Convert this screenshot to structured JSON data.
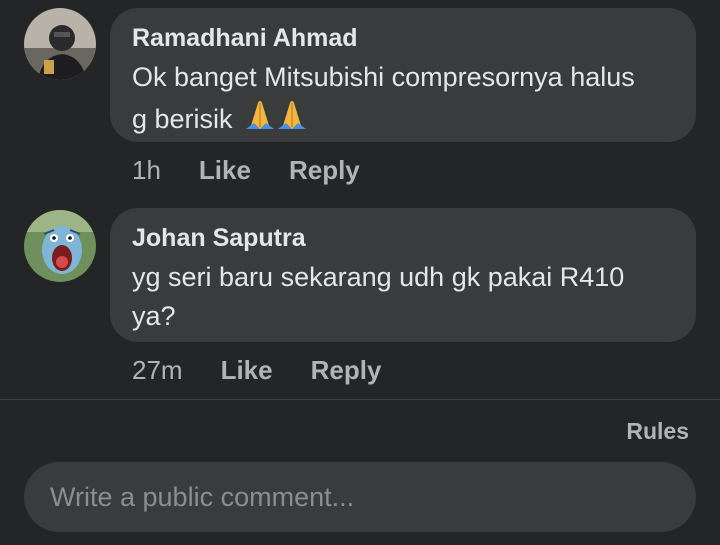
{
  "comments": [
    {
      "author": "Ramadhani Ahmad",
      "text": "Ok banget Mitsubishi compresornya halus g berisik",
      "emoji": "folded-hands-icon",
      "time": "1h",
      "like_label": "Like",
      "reply_label": "Reply"
    },
    {
      "author": "Johan Saputra",
      "text": "yg seri baru sekarang udh gk pakai R410 ya?",
      "time": "27m",
      "like_label": "Like",
      "reply_label": "Reply"
    }
  ],
  "rules_label": "Rules",
  "composer": {
    "placeholder": "Write a public comment..."
  },
  "colors": {
    "background": "#242526",
    "bubble": "#3a3b3c",
    "primary_text": "#e4e6eb",
    "secondary_text": "#b0b3b8"
  }
}
